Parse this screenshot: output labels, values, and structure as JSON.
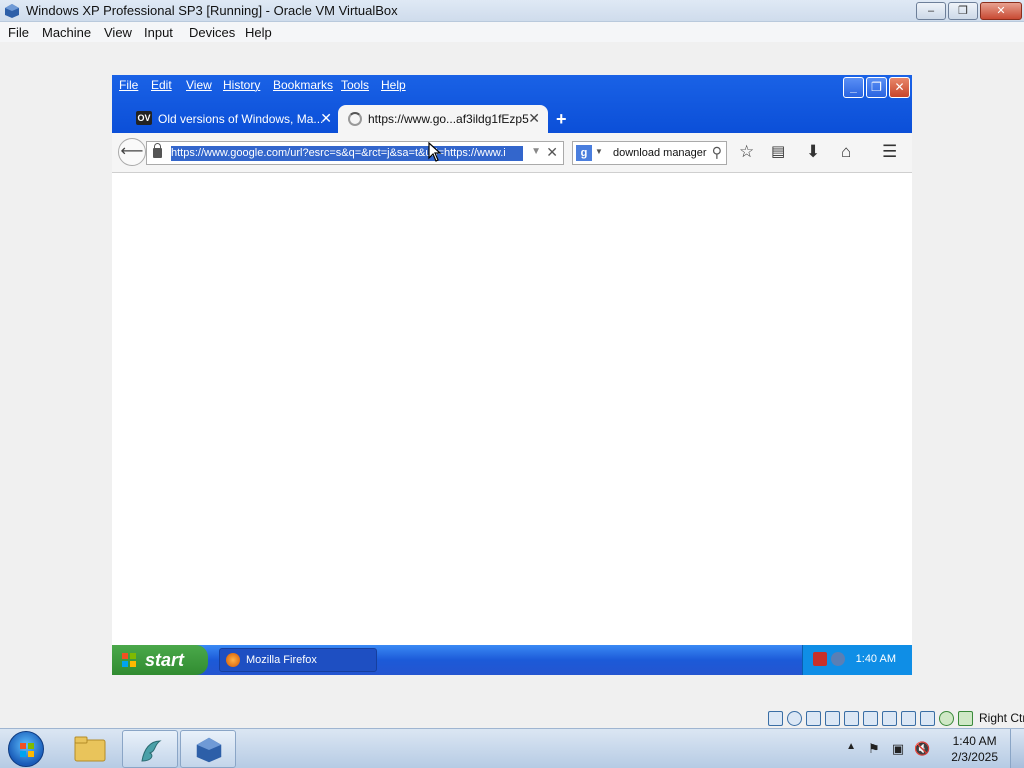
{
  "host": {
    "title": "Windows XP Professional SP3 [Running] - Oracle VM VirtualBox",
    "menu": [
      "File",
      "Machine",
      "View",
      "Input",
      "Devices",
      "Help"
    ],
    "hostkey_label": "Right Ctrl",
    "window_buttons": {
      "minimize": "–",
      "restore": "❐",
      "close": "✕"
    }
  },
  "firefox": {
    "menu": [
      "File",
      "Edit",
      "View",
      "History",
      "Bookmarks",
      "Tools",
      "Help"
    ],
    "tabs": [
      {
        "favicon_text": "OV",
        "label": "Old versions of Windows, Ma...",
        "active": false
      },
      {
        "label": "https://www.go...af3ildg1fEzp5",
        "active": true,
        "loading": true
      }
    ],
    "new_tab_label": "+",
    "url": "https://www.google.com/url?esrc=s&q=&rct=j&sa=t&url=https://www.i",
    "search_engine_letter": "g",
    "search_value": "download manager",
    "window_buttons": {
      "minimize": "_",
      "restore": "❐",
      "close": "✕"
    }
  },
  "xp_taskbar": {
    "start_label": "start",
    "task_label": "Mozilla Firefox",
    "clock": "1:40 AM"
  },
  "w7_taskbar": {
    "clock_time": "1:40 AM",
    "clock_date": "2/3/2025"
  },
  "colors": {
    "xp_blue": "#0b4fd8",
    "xp_start_green": "#318c31",
    "url_selection": "#3366cc"
  }
}
